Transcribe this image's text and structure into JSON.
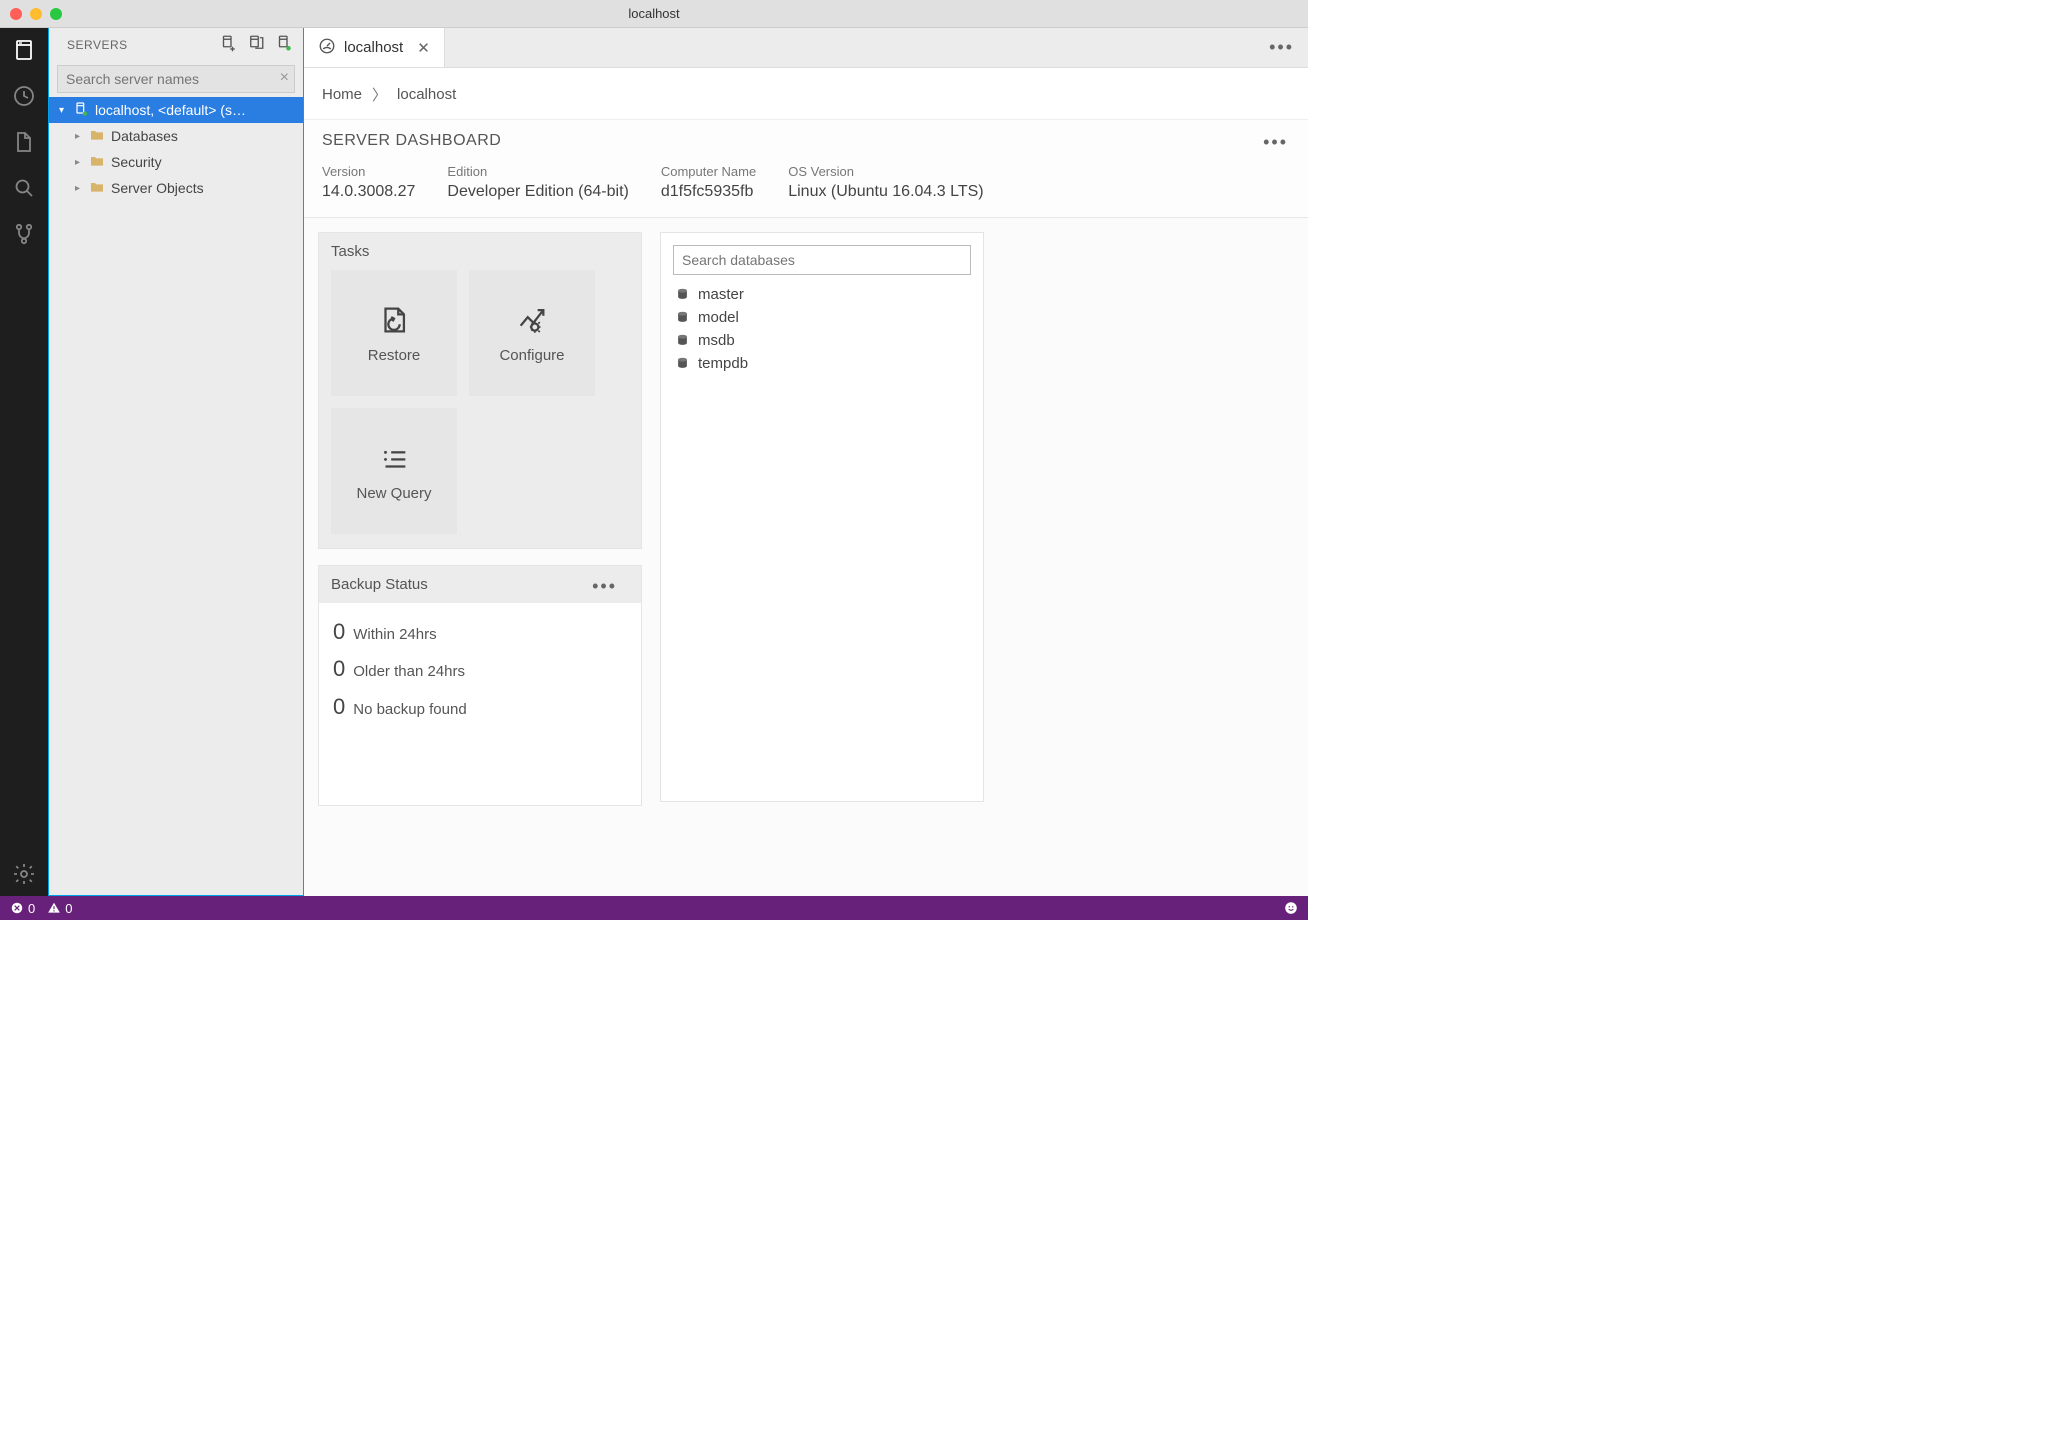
{
  "window": {
    "title": "localhost"
  },
  "sidebar": {
    "title": "SERVERS",
    "search_placeholder": "Search server names",
    "root": "localhost, <default> (s…",
    "children": [
      {
        "label": "Databases"
      },
      {
        "label": "Security"
      },
      {
        "label": "Server Objects"
      }
    ]
  },
  "tab": {
    "label": "localhost"
  },
  "breadcrumb": {
    "home": "Home",
    "current": "localhost"
  },
  "dashboard": {
    "title": "SERVER DASHBOARD",
    "info": [
      {
        "label": "Version",
        "value": "14.0.3008.27"
      },
      {
        "label": "Edition",
        "value": "Developer Edition (64-bit)"
      },
      {
        "label": "Computer Name",
        "value": "d1f5fc5935fb"
      },
      {
        "label": "OS Version",
        "value": "Linux (Ubuntu 16.04.3 LTS)"
      }
    ]
  },
  "tasks": {
    "title": "Tasks",
    "items": [
      {
        "label": "Restore"
      },
      {
        "label": "Configure"
      },
      {
        "label": "New Query"
      }
    ]
  },
  "backup": {
    "title": "Backup Status",
    "rows": [
      {
        "count": "0",
        "label": "Within 24hrs"
      },
      {
        "count": "0",
        "label": "Older than 24hrs"
      },
      {
        "count": "0",
        "label": "No backup found"
      }
    ]
  },
  "databases": {
    "search_placeholder": "Search databases",
    "items": [
      "master",
      "model",
      "msdb",
      "tempdb"
    ]
  },
  "status": {
    "errors": "0",
    "warnings": "0"
  }
}
